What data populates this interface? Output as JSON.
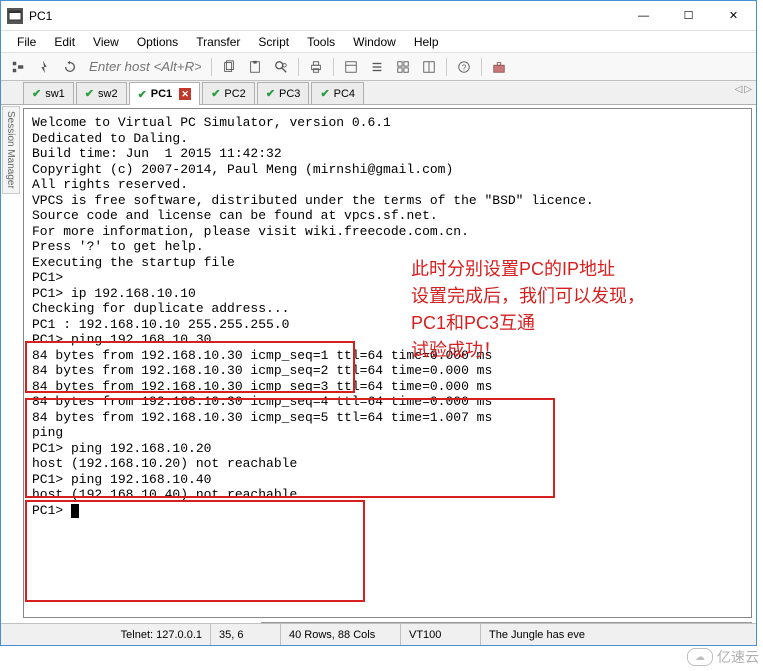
{
  "window": {
    "title": "PC1"
  },
  "menu": {
    "file": "File",
    "edit": "Edit",
    "view": "View",
    "options": "Options",
    "transfer": "Transfer",
    "script": "Script",
    "tools": "Tools",
    "window": "Window",
    "help": "Help"
  },
  "toolbar": {
    "host_placeholder": "Enter host <Alt+R>"
  },
  "tabs": {
    "items": [
      {
        "label": "sw1"
      },
      {
        "label": "sw2"
      },
      {
        "label": "PC1"
      },
      {
        "label": "PC2"
      },
      {
        "label": "PC3"
      },
      {
        "label": "PC4"
      }
    ]
  },
  "side": {
    "label": "Session Manager"
  },
  "terminal": {
    "lines": [
      "Welcome to Virtual PC Simulator, version 0.6.1",
      "Dedicated to Daling.",
      "Build time: Jun  1 2015 11:42:32",
      "Copyright (c) 2007-2014, Paul Meng (mirnshi@gmail.com)",
      "All rights reserved.",
      "",
      "VPCS is free software, distributed under the terms of the \"BSD\" licence.",
      "Source code and license can be found at vpcs.sf.net.",
      "For more information, please visit wiki.freecode.com.cn.",
      "",
      "Press '?' to get help.",
      "",
      "Executing the startup file",
      "",
      "PC1>",
      "PC1> ip 192.168.10.10",
      "Checking for duplicate address...",
      "PC1 : 192.168.10.10 255.255.255.0",
      "",
      "PC1> ping 192.168.10.30",
      "84 bytes from 192.168.10.30 icmp_seq=1 ttl=64 time=0.000 ms",
      "84 bytes from 192.168.10.30 icmp_seq=2 ttl=64 time=0.000 ms",
      "84 bytes from 192.168.10.30 icmp_seq=3 ttl=64 time=0.000 ms",
      "84 bytes from 192.168.10.30 icmp_seq=4 ttl=64 time=0.000 ms",
      "84 bytes from 192.168.10.30 icmp_seq=5 ttl=64 time=1.007 ms",
      "ping",
      "PC1> ping 192.168.10.20",
      "host (192.168.10.20) not reachable",
      "",
      "PC1> ping 192.168.10.40",
      "host (192.168.10.40) not reachable",
      "",
      "PC1> "
    ]
  },
  "annotation": {
    "l1": "此时分别设置PC的IP地址",
    "l2": "设置完成后，我们可以发现，",
    "l3": "PC1和PC3互通",
    "l4": "试验成功！"
  },
  "status": {
    "telnet": "Telnet: 127.0.0.1",
    "pos": "35,  6",
    "size": "40 Rows, 88 Cols",
    "proto": "VT100",
    "extra": "The Jungle has eve"
  },
  "watermark": "亿速云"
}
